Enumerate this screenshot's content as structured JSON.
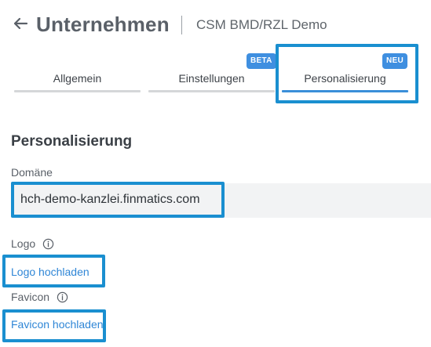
{
  "header": {
    "title": "Unternehmen",
    "subtitle": "CSM BMD/RZL Demo",
    "back_icon": "arrow-left-icon"
  },
  "tabs": [
    {
      "label": "Allgemein",
      "badge": ""
    },
    {
      "label": "Einstellungen",
      "badge": "BETA"
    },
    {
      "label": "Personalisierung",
      "badge": "NEU",
      "active": true
    }
  ],
  "section": {
    "title": "Personalisierung",
    "domain_label": "Domäne",
    "domain_value": "hch-demo-kanzlei.finmatics.com",
    "logo_label": "Logo",
    "logo_upload": "Logo hochladen",
    "favicon_label": "Favicon",
    "favicon_upload": "Favicon hochladen"
  },
  "colors": {
    "accent": "#3b8fd9",
    "badge": "#3f8fe0",
    "highlight": "#1a8fd0",
    "link": "#2f86d6"
  }
}
